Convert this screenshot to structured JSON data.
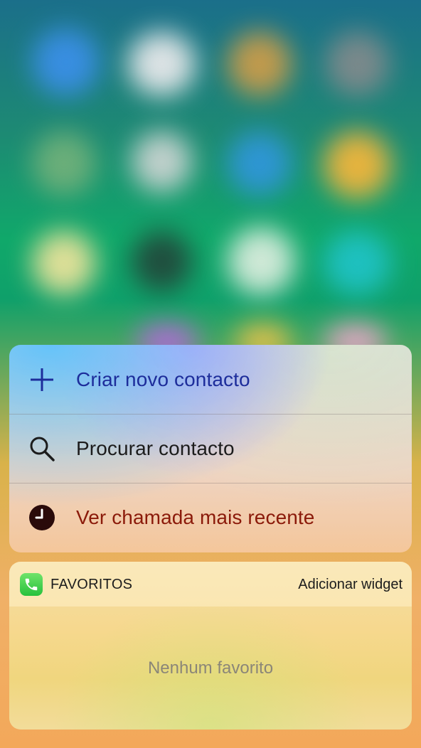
{
  "quick_actions": [
    {
      "label": "Criar novo contacto",
      "icon": "plus-icon",
      "color": "#1d2d9b"
    },
    {
      "label": "Procurar contacto",
      "icon": "search-icon",
      "color": "#1c1c1c"
    },
    {
      "label": "Ver chamada mais recente",
      "icon": "clock-icon",
      "color": "#8b1a0a"
    }
  ],
  "widget": {
    "app_icon": "phone-app-icon",
    "title": "FAVORITOS",
    "add_label": "Adicionar widget",
    "empty_text": "Nenhum favorito"
  },
  "colors": {
    "accent_blue": "#1d2d9b",
    "recent_red": "#8b1a0a",
    "phone_green": "#27c13c"
  }
}
